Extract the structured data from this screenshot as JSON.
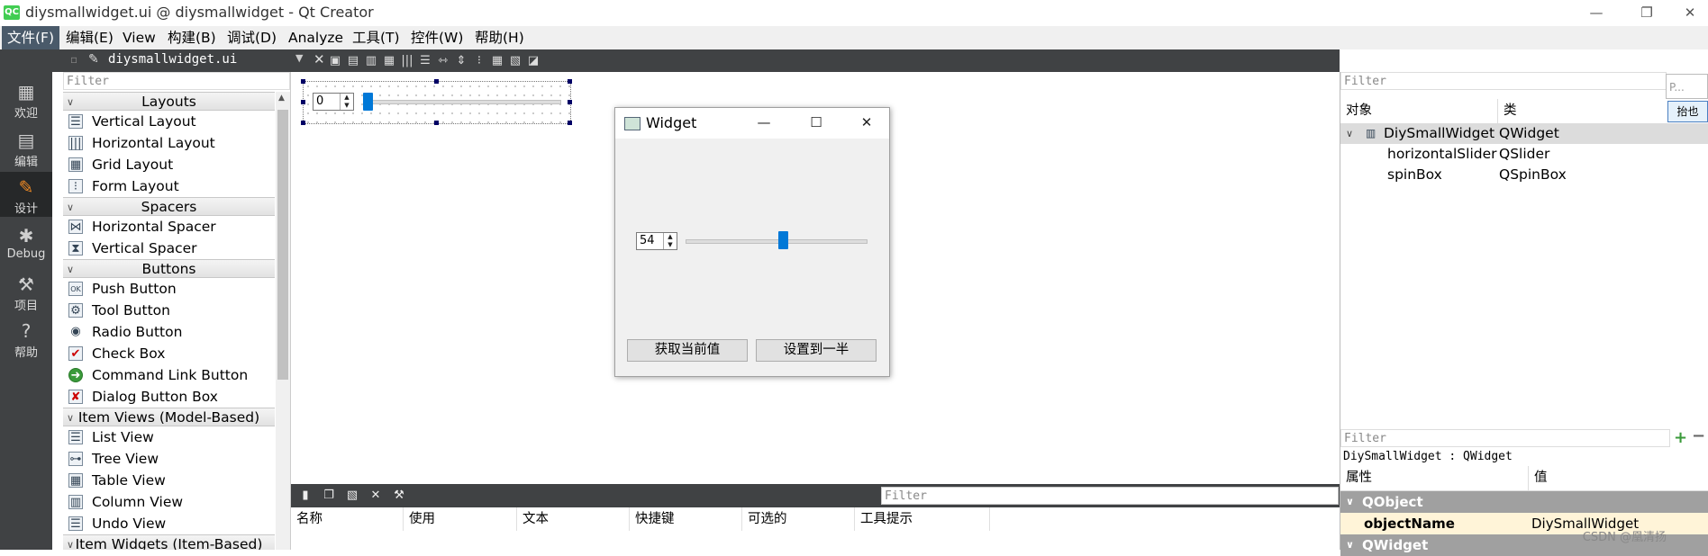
{
  "window": {
    "title": "diysmallwidget.ui @ diysmallwidget - Qt Creator",
    "logo_text": "QC",
    "minimize": "—",
    "restore": "❐",
    "close": "✕"
  },
  "menubar": {
    "items": [
      "文件(F)",
      "编辑(E)",
      "View",
      "构建(B)",
      "调试(D)",
      "Analyze",
      "工具(T)",
      "控件(W)",
      "帮助(H)"
    ]
  },
  "modebar": {
    "items": [
      {
        "label": "欢迎",
        "icon": "grid-icon"
      },
      {
        "label": "编辑",
        "icon": "edit-doc-icon"
      },
      {
        "label": "设计",
        "icon": "pencil-icon"
      },
      {
        "label": "Debug",
        "icon": "bug-icon"
      },
      {
        "label": "项目",
        "icon": "wrench-icon"
      },
      {
        "label": "帮助",
        "icon": "help-icon"
      }
    ]
  },
  "editor": {
    "document_name": "diysmallwidget.ui"
  },
  "widgetbox": {
    "filter_placeholder": "Filter",
    "categories": [
      {
        "name": "Layouts",
        "items": [
          "Vertical Layout",
          "Horizontal Layout",
          "Grid Layout",
          "Form Layout"
        ]
      },
      {
        "name": "Spacers",
        "items": [
          "Horizontal Spacer",
          "Vertical Spacer"
        ]
      },
      {
        "name": "Buttons",
        "items": [
          "Push Button",
          "Tool Button",
          "Radio Button",
          "Check Box",
          "Command Link Button",
          "Dialog Button Box"
        ]
      },
      {
        "name": "Item Views (Model-Based)",
        "items": [
          "List View",
          "Tree View",
          "Table View",
          "Column View",
          "Undo View"
        ]
      },
      {
        "name": "Item Widgets (Item-Based)",
        "items": []
      }
    ]
  },
  "form": {
    "spin_value": "0"
  },
  "preview": {
    "title": "Widget",
    "spin_value": "54",
    "slider_value": 54,
    "slider_max": 99,
    "btn_get": "获取当前值",
    "btn_set": "设置到一半"
  },
  "action_editor": {
    "filter_placeholder": "Filter",
    "columns": [
      "名称",
      "使用",
      "文本",
      "快捷键",
      "可选的",
      "工具提示"
    ]
  },
  "object_inspector": {
    "filter_placeholder": "Filter",
    "small_placeholder": "P...",
    "small_button": "抬也",
    "col_object": "对象",
    "col_class": "类",
    "rows": [
      {
        "name": "DiySmallWidget",
        "class": "QWidget"
      },
      {
        "name": "horizontalSlider",
        "class": "QSlider"
      },
      {
        "name": "spinBox",
        "class": "QSpinBox"
      }
    ]
  },
  "property_editor": {
    "filter_placeholder": "Filter",
    "context": "DiySmallWidget : QWidget",
    "col_property": "属性",
    "col_value": "值",
    "group1": "QObject",
    "prop_name": "objectName",
    "prop_value": "DiySmallWidget",
    "group2": "QWidget"
  },
  "watermark": "CSDN @凰清扬"
}
